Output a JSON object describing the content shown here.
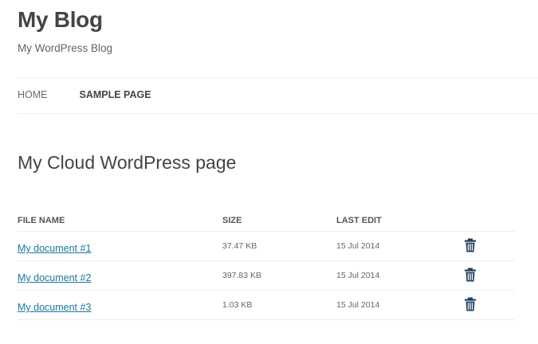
{
  "site": {
    "title": "My Blog",
    "description": "My WordPress Blog"
  },
  "nav": {
    "items": [
      {
        "label": "HOME"
      },
      {
        "label": "SAMPLE PAGE",
        "current": true
      }
    ]
  },
  "page": {
    "title": "My Cloud WordPress page"
  },
  "files": {
    "headers": {
      "name": "FILE NAME",
      "size": "SIZE",
      "edit": "LAST EDIT"
    },
    "rows": [
      {
        "name": "My document #1",
        "size": "37.47 KB",
        "date": "15 Jul 2014",
        "action_icon": "trash-icon"
      },
      {
        "name": "My document #2",
        "size": "397.83 KB",
        "date": "15 Jul 2014",
        "action_icon": "trash-icon"
      },
      {
        "name": "My document #3",
        "size": "1.03 KB",
        "date": "15 Jul 2014",
        "action_icon": "trash-icon"
      }
    ]
  },
  "colors": {
    "link": "#21759b",
    "trash_icon": "#21415c",
    "text": "#444444",
    "divider": "#ededed"
  }
}
